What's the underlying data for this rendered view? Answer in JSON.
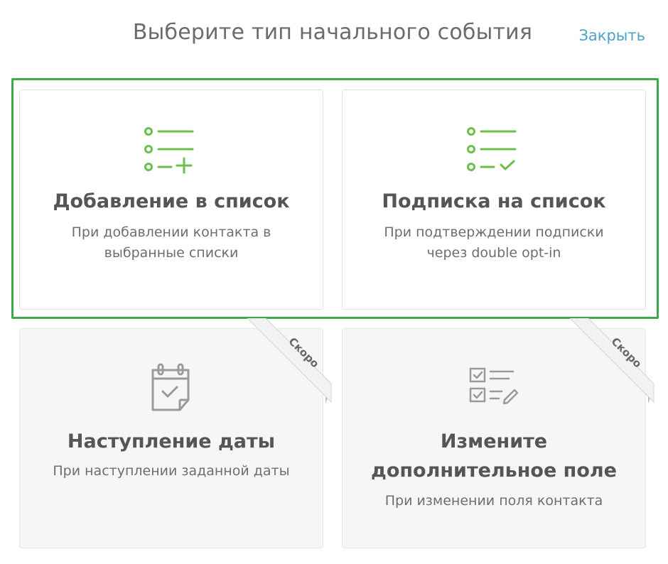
{
  "header": {
    "title": "Выберите тип начального события",
    "close_label": "Закрыть"
  },
  "colors": {
    "accent_green": "#6cbf4a",
    "highlight_green": "#3aab4a",
    "link_blue": "#4aa3c9",
    "disabled_icon": "#9a9a9a"
  },
  "cards": [
    {
      "title": "Добавление в список",
      "description": "При добавлении контакта в выбранные списки",
      "icon": "list-add-icon",
      "disabled": false
    },
    {
      "title": "Подписка на список",
      "description": "При подтверждении подписки через double opt-in",
      "icon": "list-check-icon",
      "disabled": false
    },
    {
      "title": "Наступление даты",
      "description": "При наступлении заданной даты",
      "icon": "calendar-check-icon",
      "disabled": true,
      "badge": "Скоро"
    },
    {
      "title": "Измените дополнительное поле",
      "description": "При изменении поля контакта",
      "icon": "checklist-edit-icon",
      "disabled": true,
      "badge": "Скоро"
    }
  ]
}
